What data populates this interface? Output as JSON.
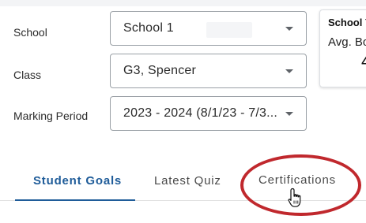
{
  "filters": {
    "school": {
      "label": "School",
      "value": "School 1"
    },
    "class": {
      "label": "Class",
      "value": "G3, Spencer"
    },
    "marking_period": {
      "label": "Marking Period",
      "value": "2023 - 2024 (8/1/23 - 7/3..."
    }
  },
  "card": {
    "title": "School Y",
    "subtitle": "Avg. Bo",
    "value": "4"
  },
  "tabs": [
    {
      "label": "Student Goals",
      "active": true
    },
    {
      "label": "Latest Quiz",
      "active": false
    },
    {
      "label": "Certifications",
      "active": false
    }
  ],
  "colors": {
    "accent": "#1f5c99",
    "highlight": "#c0282d"
  }
}
